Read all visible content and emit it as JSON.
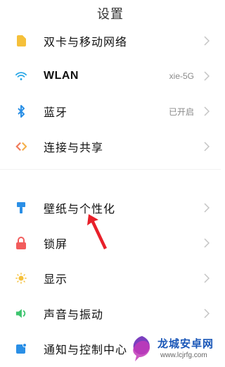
{
  "header": {
    "title": "设置"
  },
  "items": [
    {
      "label": "双卡与移动网络",
      "value": "",
      "icon": "sim-card-icon",
      "color": "#f5c03a"
    },
    {
      "label": "WLAN",
      "value": "xie-5G",
      "icon": "wifi-icon",
      "color": "#2aa7e6"
    },
    {
      "label": "蓝牙",
      "value": "已开启",
      "icon": "bluetooth-icon",
      "color": "#2a8fe6"
    },
    {
      "label": "连接与共享",
      "value": "",
      "icon": "share-icon",
      "color": "#f07a5a"
    },
    {
      "label": "壁纸与个性化",
      "value": "",
      "icon": "brush-icon",
      "color": "#2a8fe6"
    },
    {
      "label": "锁屏",
      "value": "",
      "icon": "lock-icon",
      "color": "#f25c5c"
    },
    {
      "label": "显示",
      "value": "",
      "icon": "sun-icon",
      "color": "#f5c03a"
    },
    {
      "label": "声音与振动",
      "value": "",
      "icon": "speaker-icon",
      "color": "#3cc46e"
    },
    {
      "label": "通知与控制中心",
      "value": "",
      "icon": "notification-icon",
      "color": "#2a8fe6"
    }
  ],
  "watermark": {
    "text": "龙城安卓网",
    "url": "www.lcjrfg.com"
  },
  "annotation": {
    "color": "#e8202a"
  }
}
